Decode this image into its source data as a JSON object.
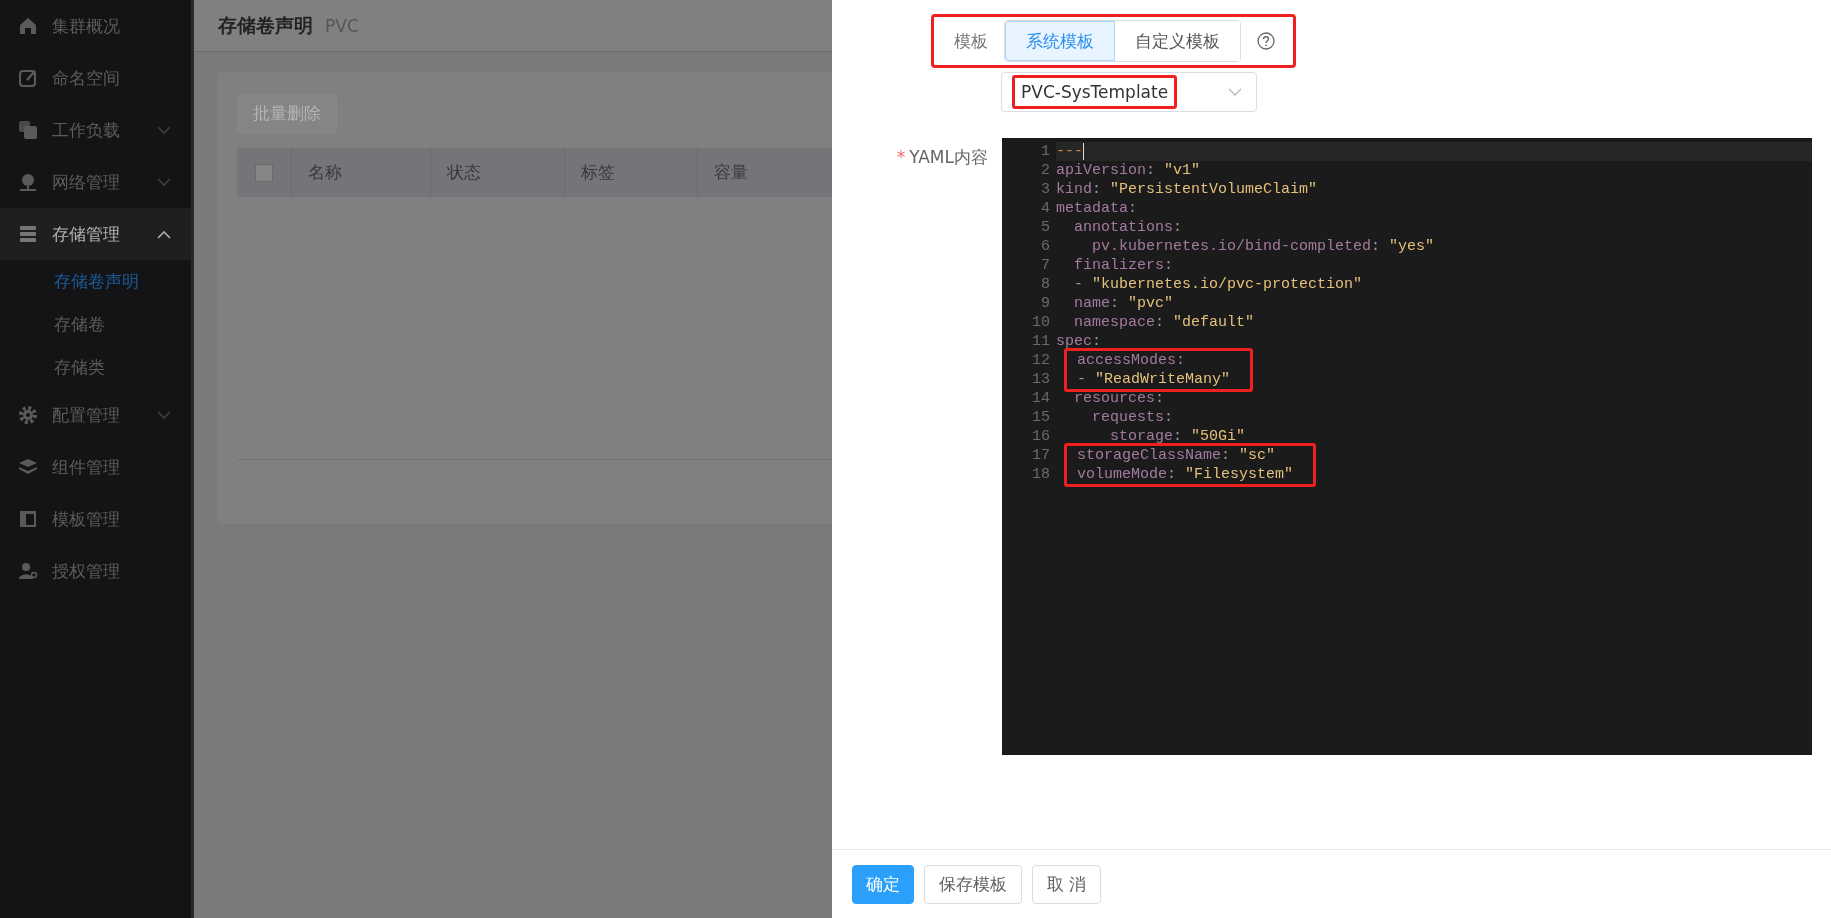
{
  "sidebar": {
    "items": [
      {
        "label": "集群概况",
        "kind": "link"
      },
      {
        "label": "命名空间",
        "kind": "link"
      },
      {
        "label": "工作负载",
        "kind": "group",
        "expanded": false
      },
      {
        "label": "网络管理",
        "kind": "group",
        "expanded": false
      },
      {
        "label": "存储管理",
        "kind": "group",
        "expanded": true,
        "children": [
          {
            "label": "存储卷声明",
            "selected": true
          },
          {
            "label": "存储卷",
            "selected": false
          },
          {
            "label": "存储类",
            "selected": false
          }
        ]
      },
      {
        "label": "配置管理",
        "kind": "group",
        "expanded": false
      },
      {
        "label": "组件管理",
        "kind": "link"
      },
      {
        "label": "模板管理",
        "kind": "link"
      },
      {
        "label": "授权管理",
        "kind": "link"
      }
    ]
  },
  "page": {
    "title": "存储卷声明",
    "subtitle": "PVC",
    "batch_delete": {
      "label": "批量删除",
      "disabled": true
    },
    "table": {
      "select_all_checked": false,
      "columns": [
        "名称",
        "状态",
        "标签",
        "容量"
      ]
    }
  },
  "drawer": {
    "template": {
      "label": "模板",
      "highlighted": true,
      "options": [
        {
          "label": "系统模板",
          "selected": true
        },
        {
          "label": "自定义模板",
          "selected": false
        }
      ]
    },
    "template_select": {
      "value": "PVC-SysTemplate",
      "highlighted": true
    },
    "yaml": {
      "label": "YAML内容",
      "required_mark": "*",
      "lines": [
        {
          "number": "1",
          "boxed": false,
          "tokens": [
            {
              "kind": "doc",
              "text": "---"
            }
          ]
        },
        {
          "number": "2",
          "boxed": false,
          "tokens": [
            {
              "kind": "key",
              "text": "apiVersion"
            },
            {
              "kind": "punct",
              "text": ": "
            },
            {
              "kind": "string",
              "text": "\"v1\""
            }
          ]
        },
        {
          "number": "3",
          "boxed": false,
          "tokens": [
            {
              "kind": "key",
              "text": "kind"
            },
            {
              "kind": "punct",
              "text": ": "
            },
            {
              "kind": "string",
              "text": "\"PersistentVolumeClaim\""
            }
          ]
        },
        {
          "number": "4",
          "boxed": false,
          "tokens": [
            {
              "kind": "key",
              "text": "metadata"
            },
            {
              "kind": "punct",
              "text": ":"
            }
          ]
        },
        {
          "number": "5",
          "boxed": false,
          "tokens": [
            {
              "kind": "key",
              "text": "  annotations"
            },
            {
              "kind": "punct",
              "text": ":"
            }
          ]
        },
        {
          "number": "6",
          "boxed": false,
          "tokens": [
            {
              "kind": "key",
              "text": "    pv.kubernetes.io/bind-completed"
            },
            {
              "kind": "punct",
              "text": ": "
            },
            {
              "kind": "string",
              "text": "\"yes\""
            }
          ]
        },
        {
          "number": "7",
          "boxed": false,
          "tokens": [
            {
              "kind": "key",
              "text": "  finalizers"
            },
            {
              "kind": "punct",
              "text": ":"
            }
          ]
        },
        {
          "number": "8",
          "boxed": false,
          "tokens": [
            {
              "kind": "punct",
              "text": "  - "
            },
            {
              "kind": "string",
              "text": "\"kubernetes.io/pvc-protection\""
            }
          ]
        },
        {
          "number": "9",
          "boxed": false,
          "tokens": [
            {
              "kind": "key",
              "text": "  name"
            },
            {
              "kind": "punct",
              "text": ": "
            },
            {
              "kind": "string",
              "text": "\"pvc\""
            }
          ]
        },
        {
          "number": "10",
          "boxed": false,
          "tokens": [
            {
              "kind": "key",
              "text": "  namespace"
            },
            {
              "kind": "punct",
              "text": ": "
            },
            {
              "kind": "string",
              "text": "\"default\""
            }
          ]
        },
        {
          "number": "11",
          "boxed": false,
          "tokens": [
            {
              "kind": "key",
              "text": "spec"
            },
            {
              "kind": "punct",
              "text": ":"
            }
          ]
        },
        {
          "number": "12",
          "boxed": true,
          "tokens": [
            {
              "kind": "key",
              "text": "  accessModes"
            },
            {
              "kind": "punct",
              "text": ":"
            }
          ]
        },
        {
          "number": "13",
          "boxed": true,
          "tokens": [
            {
              "kind": "punct",
              "text": "  - "
            },
            {
              "kind": "string",
              "text": "\"ReadWriteMany\""
            }
          ]
        },
        {
          "number": "14",
          "boxed": false,
          "tokens": [
            {
              "kind": "key",
              "text": "  resources"
            },
            {
              "kind": "punct",
              "text": ":"
            }
          ]
        },
        {
          "number": "15",
          "boxed": false,
          "tokens": [
            {
              "kind": "key",
              "text": "    requests"
            },
            {
              "kind": "punct",
              "text": ":"
            }
          ]
        },
        {
          "number": "16",
          "boxed": false,
          "tokens": [
            {
              "kind": "key",
              "text": "      storage"
            },
            {
              "kind": "punct",
              "text": ": "
            },
            {
              "kind": "string",
              "text": "\"50Gi\""
            }
          ]
        },
        {
          "number": "17",
          "boxed": true,
          "tokens": [
            {
              "kind": "key",
              "text": "  storageClassName"
            },
            {
              "kind": "punct",
              "text": ": "
            },
            {
              "kind": "string",
              "text": "\"sc\""
            }
          ]
        },
        {
          "number": "18",
          "boxed": true,
          "tokens": [
            {
              "kind": "key",
              "text": "  volumeMode"
            },
            {
              "kind": "punct",
              "text": ": "
            },
            {
              "kind": "string",
              "text": "\"Filesystem\""
            }
          ]
        }
      ]
    },
    "buttons": [
      {
        "label": "确定",
        "kind": "primary"
      },
      {
        "label": "保存模板",
        "kind": "default"
      },
      {
        "label": "取 消",
        "kind": "default"
      }
    ]
  }
}
